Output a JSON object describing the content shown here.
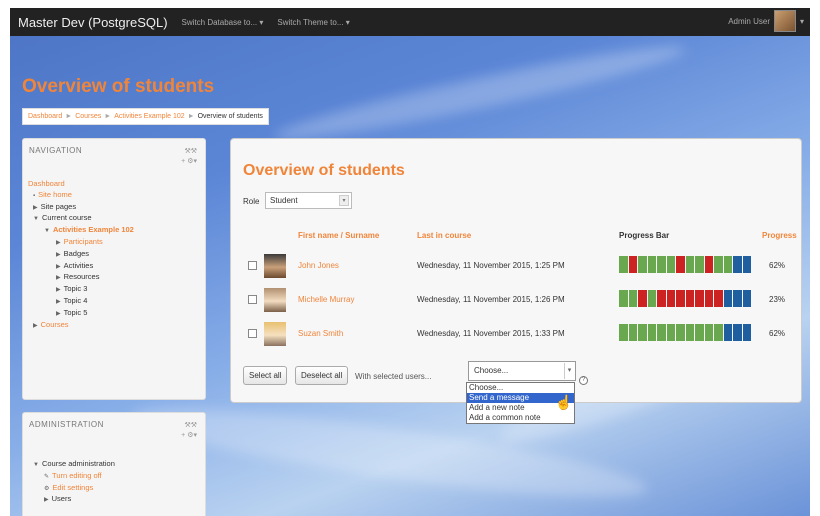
{
  "topbar": {
    "brand": "Master Dev (PostgreSQL)",
    "switch_db": "Switch Database to... ▾",
    "switch_theme": "Switch Theme to... ▾",
    "user_name": "Admin User",
    "user_caret": "▾"
  },
  "page_title": "Overview of students",
  "breadcrumb": {
    "items": [
      "Dashboard",
      "Courses",
      "Activities Example 102"
    ],
    "current": "Overview of students",
    "separator": "►"
  },
  "navigation": {
    "title": "NAVIGATION",
    "controls": "⚒⚒",
    "add": "+ ⚙▾",
    "items": [
      {
        "label": "Dashboard",
        "toggle": ""
      },
      {
        "label": "Site home",
        "toggle": "▪"
      },
      {
        "label": "Site pages",
        "toggle": "▶"
      },
      {
        "label": "Current course",
        "toggle": "▼"
      },
      {
        "label": "Activities Example 102",
        "toggle": "▼"
      },
      {
        "label": "Participants",
        "toggle": "▶"
      },
      {
        "label": "Badges",
        "toggle": "▶"
      },
      {
        "label": "Activities",
        "toggle": "▶"
      },
      {
        "label": "Resources",
        "toggle": "▶"
      },
      {
        "label": "Topic 3",
        "toggle": "▶"
      },
      {
        "label": "Topic 4",
        "toggle": "▶"
      },
      {
        "label": "Topic 5",
        "toggle": "▶"
      },
      {
        "label": "Courses",
        "toggle": "▶"
      }
    ]
  },
  "administration": {
    "title": "ADMINISTRATION",
    "controls": "⚒⚒",
    "add": "+ ⚙▾",
    "items": [
      {
        "label": "Course administration",
        "toggle": "▼"
      },
      {
        "label": "Turn editing off",
        "toggle": "✎"
      },
      {
        "label": "Edit settings",
        "toggle": "⚙"
      },
      {
        "label": "Users",
        "toggle": "▶"
      }
    ]
  },
  "main": {
    "title": "Overview of students",
    "role_label": "Role",
    "role_value": "Student",
    "role_arrow": "▾",
    "headers": {
      "name": "First name / Surname",
      "last": "Last in course",
      "bar": "Progress Bar",
      "progress": "Progress"
    },
    "rows": [
      {
        "name": "John Jones",
        "last": "Wednesday, 11 November 2015, 1:25 PM",
        "progress": "62%",
        "segments": [
          "#6aa84f",
          "#cc2222",
          "#6aa84f",
          "#6aa84f",
          "#6aa84f",
          "#6aa84f",
          "#cc2222",
          "#6aa84f",
          "#6aa84f",
          "#cc2222",
          "#6aa84f",
          "#6aa84f",
          "#1f5fa0",
          "#1f5fa0"
        ]
      },
      {
        "name": "Michelle Murray",
        "last": "Wednesday, 11 November 2015, 1:26 PM",
        "progress": "23%",
        "segments": [
          "#6aa84f",
          "#6aa84f",
          "#cc2222",
          "#6aa84f",
          "#cc2222",
          "#cc2222",
          "#cc2222",
          "#cc2222",
          "#cc2222",
          "#cc2222",
          "#cc2222",
          "#1f5fa0",
          "#1f5fa0",
          "#1f5fa0"
        ]
      },
      {
        "name": "Suzan Smith",
        "last": "Wednesday, 11 November 2015, 1:33 PM",
        "progress": "62%",
        "segments": [
          "#6aa84f",
          "#6aa84f",
          "#6aa84f",
          "#6aa84f",
          "#6aa84f",
          "#6aa84f",
          "#6aa84f",
          "#6aa84f",
          "#6aa84f",
          "#6aa84f",
          "#6aa84f",
          "#1f5fa0",
          "#1f5fa0",
          "#1f5fa0"
        ]
      }
    ],
    "select_all": "Select all",
    "deselect_all": "Deselect all",
    "with_selected": "With selected users...",
    "choose": "Choose...",
    "choose_arrow": "▾",
    "help": "?"
  },
  "dropdown": {
    "options": [
      "Choose...",
      "Send a message",
      "Add a new note",
      "Add a common note"
    ],
    "selected_index": 1
  },
  "colors": {
    "accent": "#f0853a",
    "done": "#6aa84f",
    "missed": "#cc2222",
    "future": "#1f5fa0"
  },
  "cursor_icon": "☝"
}
